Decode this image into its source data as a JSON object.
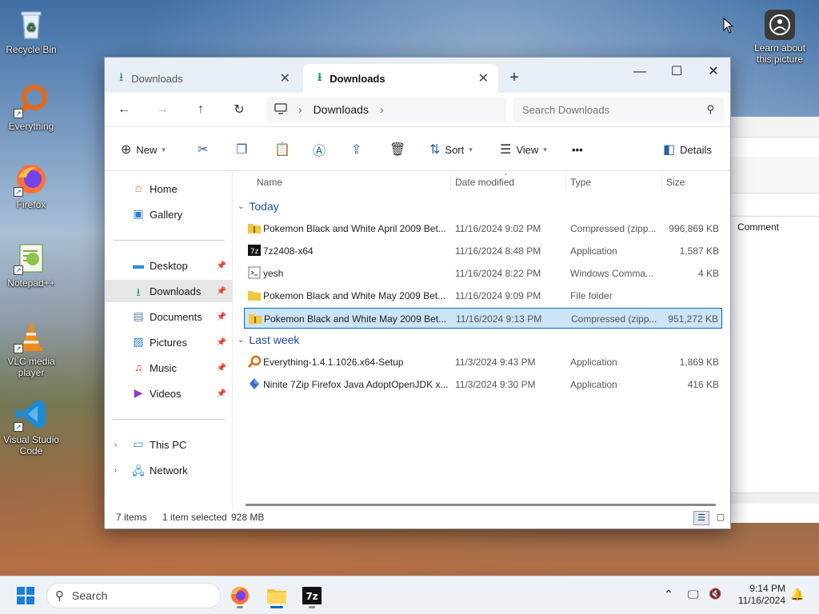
{
  "desktop": {
    "icons": [
      {
        "label": "Recycle Bin",
        "icon": "recycle-bin-icon"
      },
      {
        "label": "Everything",
        "icon": "everything-icon"
      },
      {
        "label": "Firefox",
        "icon": "firefox-icon"
      },
      {
        "label": "Notepad++",
        "icon": "notepadpp-icon"
      },
      {
        "label": "VLC media player",
        "icon": "vlc-icon"
      },
      {
        "label": "Visual Studio Code",
        "icon": "vscode-icon"
      }
    ],
    "learn_about": "Learn about this picture"
  },
  "background_window": {
    "column": "Comment"
  },
  "window": {
    "tabs": [
      {
        "label": "Downloads",
        "active": false
      },
      {
        "label": "Downloads",
        "active": true
      }
    ],
    "new_tab": "+",
    "controls": {
      "minimize": "—",
      "maximize": "☐",
      "close": "✕"
    },
    "address": {
      "crumb": "Downloads",
      "placeholder": "Search Downloads"
    },
    "toolbar": {
      "new": "New",
      "sort": "Sort",
      "view": "View",
      "more": "•••",
      "details": "Details"
    },
    "nav": {
      "top": [
        {
          "label": "Home",
          "icon": "home-icon"
        },
        {
          "label": "Gallery",
          "icon": "gallery-icon"
        }
      ],
      "quick": [
        {
          "label": "Desktop",
          "icon": "desktop-folder-icon"
        },
        {
          "label": "Downloads",
          "icon": "downloads-folder-icon",
          "selected": true
        },
        {
          "label": "Documents",
          "icon": "documents-folder-icon"
        },
        {
          "label": "Pictures",
          "icon": "pictures-folder-icon"
        },
        {
          "label": "Music",
          "icon": "music-folder-icon"
        },
        {
          "label": "Videos",
          "icon": "videos-folder-icon"
        }
      ],
      "bottom": [
        {
          "label": "This PC",
          "icon": "this-pc-icon"
        },
        {
          "label": "Network",
          "icon": "network-icon"
        }
      ]
    },
    "columns": {
      "name": "Name",
      "date": "Date modified",
      "type": "Type",
      "size": "Size"
    },
    "groups": [
      {
        "label": "Today",
        "files": [
          {
            "name": "Pokemon Black and White April 2009 Bet...",
            "date": "11/16/2024 9:02 PM",
            "type": "Compressed (zipp...",
            "size": "996,869 KB",
            "icon": "zip-folder-icon"
          },
          {
            "name": "7z2408-x64",
            "date": "11/16/2024 8:48 PM",
            "type": "Application",
            "size": "1,587 KB",
            "icon": "7zip-icon"
          },
          {
            "name": "yesh",
            "date": "11/16/2024 8:22 PM",
            "type": "Windows Comma...",
            "size": "4 KB",
            "icon": "batch-file-icon"
          },
          {
            "name": "Pokemon Black and White May 2009 Bet...",
            "date": "11/16/2024 9:09 PM",
            "type": "File folder",
            "size": "",
            "icon": "folder-icon"
          },
          {
            "name": "Pokemon Black and White May 2009 Bet...",
            "date": "11/16/2024 9:13 PM",
            "type": "Compressed (zipp...",
            "size": "951,272 KB",
            "icon": "zip-folder-icon",
            "selected": true
          }
        ]
      },
      {
        "label": "Last week",
        "files": [
          {
            "name": "Everything-1.4.1.1026.x64-Setup",
            "date": "11/3/2024 9:43 PM",
            "type": "Application",
            "size": "1,869 KB",
            "icon": "everything-icon"
          },
          {
            "name": "Ninite 7Zip Firefox Java AdoptOpenJDK x...",
            "date": "11/3/2024 9:30 PM",
            "type": "Application",
            "size": "416 KB",
            "icon": "ninite-icon"
          }
        ]
      }
    ],
    "status": {
      "items": "7 items",
      "selected": "1 item selected",
      "size": "928 MB"
    }
  },
  "taskbar": {
    "search_placeholder": "Search",
    "time": "9:14 PM",
    "date": "11/16/2024"
  }
}
